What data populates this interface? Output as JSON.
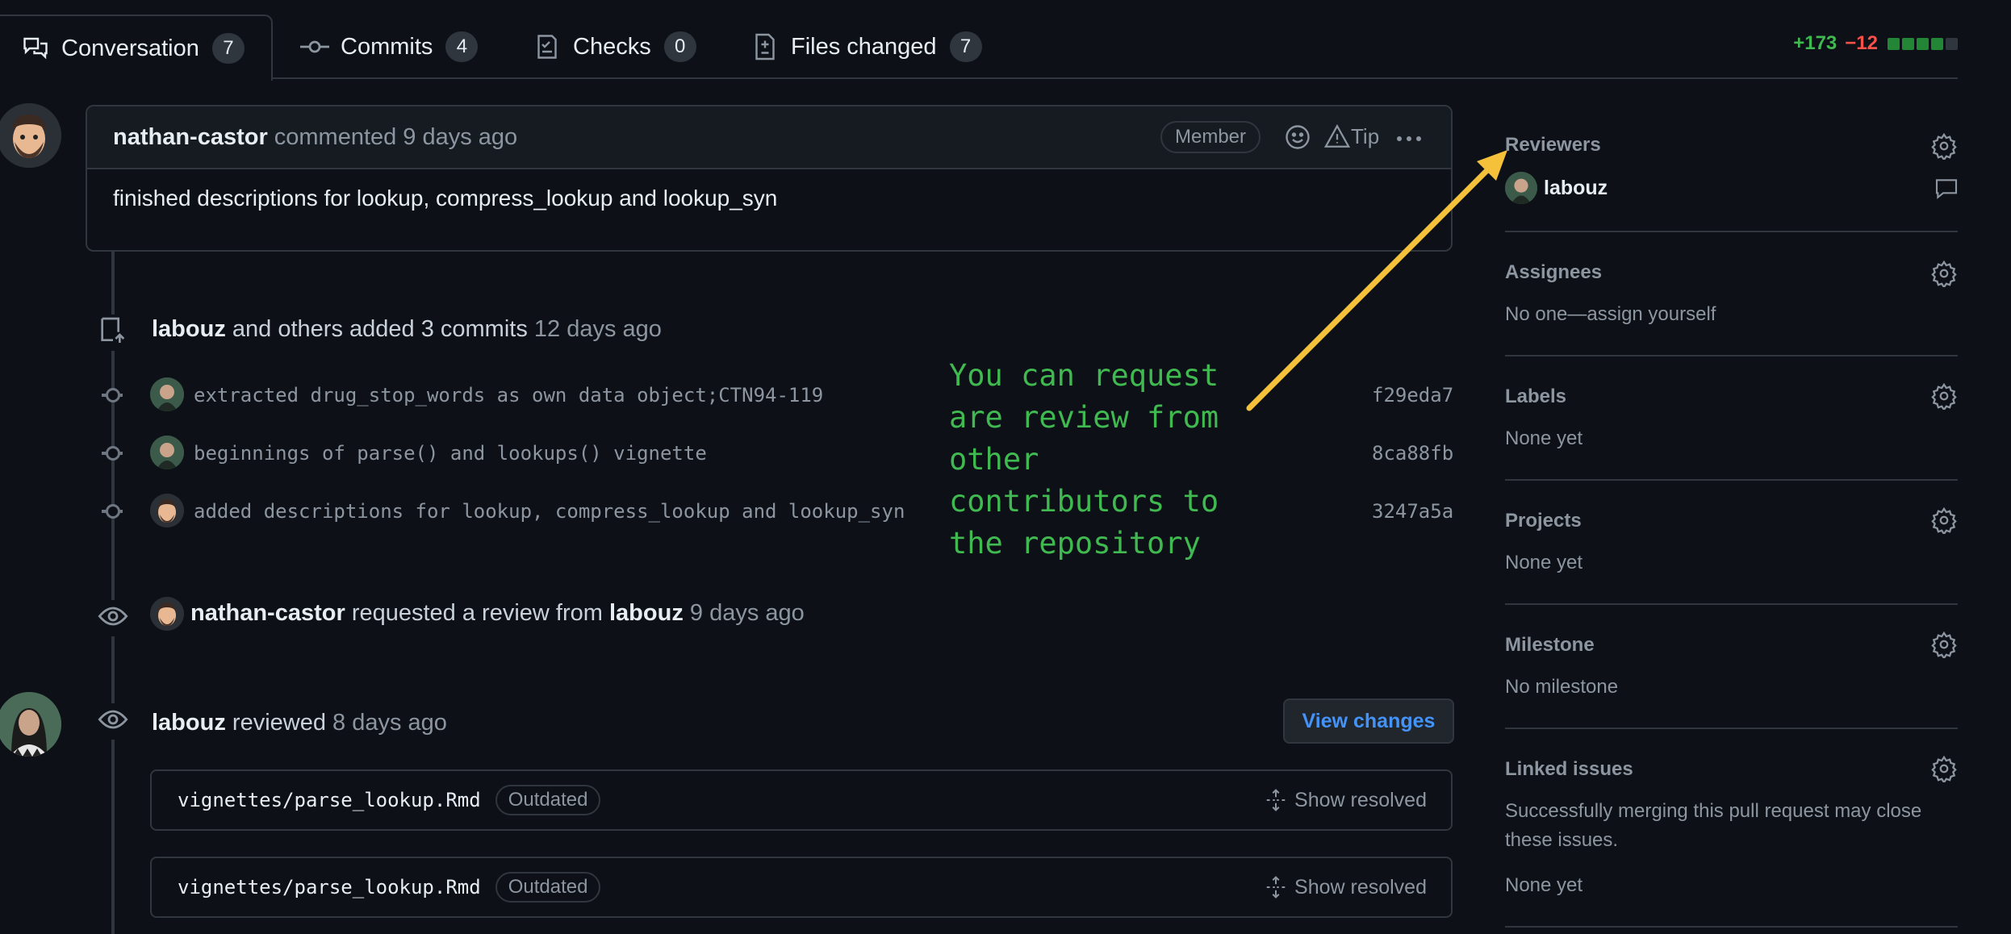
{
  "tabs": [
    {
      "label": "Conversation",
      "count": "7"
    },
    {
      "label": "Commits",
      "count": "4"
    },
    {
      "label": "Checks",
      "count": "0"
    },
    {
      "label": "Files changed",
      "count": "7"
    }
  ],
  "diffstat": {
    "additions": "+173",
    "deletions": "−12",
    "blocks": [
      "#238636",
      "#238636",
      "#238636",
      "#238636",
      "#30363d"
    ]
  },
  "comment": {
    "author": "nathan-castor",
    "action": "commented",
    "time": "9 days ago",
    "badge": "Member",
    "tip": "Tip",
    "body": "finished descriptions for lookup, compress_lookup and lookup_syn"
  },
  "commits_event": {
    "author": "labouz",
    "text": "and others added 3 commits",
    "time": "12 days ago"
  },
  "commits": [
    {
      "message": "extracted drug_stop_words as own data object;CTN94-119",
      "sha": "f29eda7"
    },
    {
      "message": "beginnings of parse() and lookups() vignette",
      "sha": "8ca88fb"
    },
    {
      "message": "added descriptions for lookup, compress_lookup and lookup_syn",
      "sha": "3247a5a"
    }
  ],
  "review_request": {
    "author": "nathan-castor",
    "text": "requested a review from",
    "reviewer": "labouz",
    "time": "9 days ago"
  },
  "review": {
    "author": "labouz",
    "text": "reviewed",
    "time": "8 days ago",
    "button": "View changes"
  },
  "files": [
    {
      "name": "vignettes/parse_lookup.Rmd",
      "badge": "Outdated",
      "action": "Show resolved"
    },
    {
      "name": "vignettes/parse_lookup.Rmd",
      "badge": "Outdated",
      "action": "Show resolved"
    }
  ],
  "annotation": "You can request\nare review from\nother\ncontributors to\nthe repository",
  "annotation_color": "#3fb950",
  "arrow_color": "#f5c13b",
  "sidebar": {
    "reviewers": {
      "title": "Reviewers",
      "name": "labouz"
    },
    "assignees": {
      "title": "Assignees",
      "value": "No one—assign yourself"
    },
    "labels": {
      "title": "Labels",
      "value": "None yet"
    },
    "projects": {
      "title": "Projects",
      "value": "None yet"
    },
    "milestone": {
      "title": "Milestone",
      "value": "No milestone"
    },
    "linked": {
      "title": "Linked issues",
      "desc_line1": "Successfully merging this pull request may close",
      "desc_line2": "these issues.",
      "value": "None yet"
    }
  },
  "icons": [
    "conversation-icon",
    "commit-icon",
    "checks-icon",
    "file-diff-icon",
    "smiley-icon",
    "alert-icon",
    "kebab-icon",
    "push-icon",
    "eye-icon",
    "unfold-icon",
    "gear-icon",
    "comment-icon"
  ]
}
